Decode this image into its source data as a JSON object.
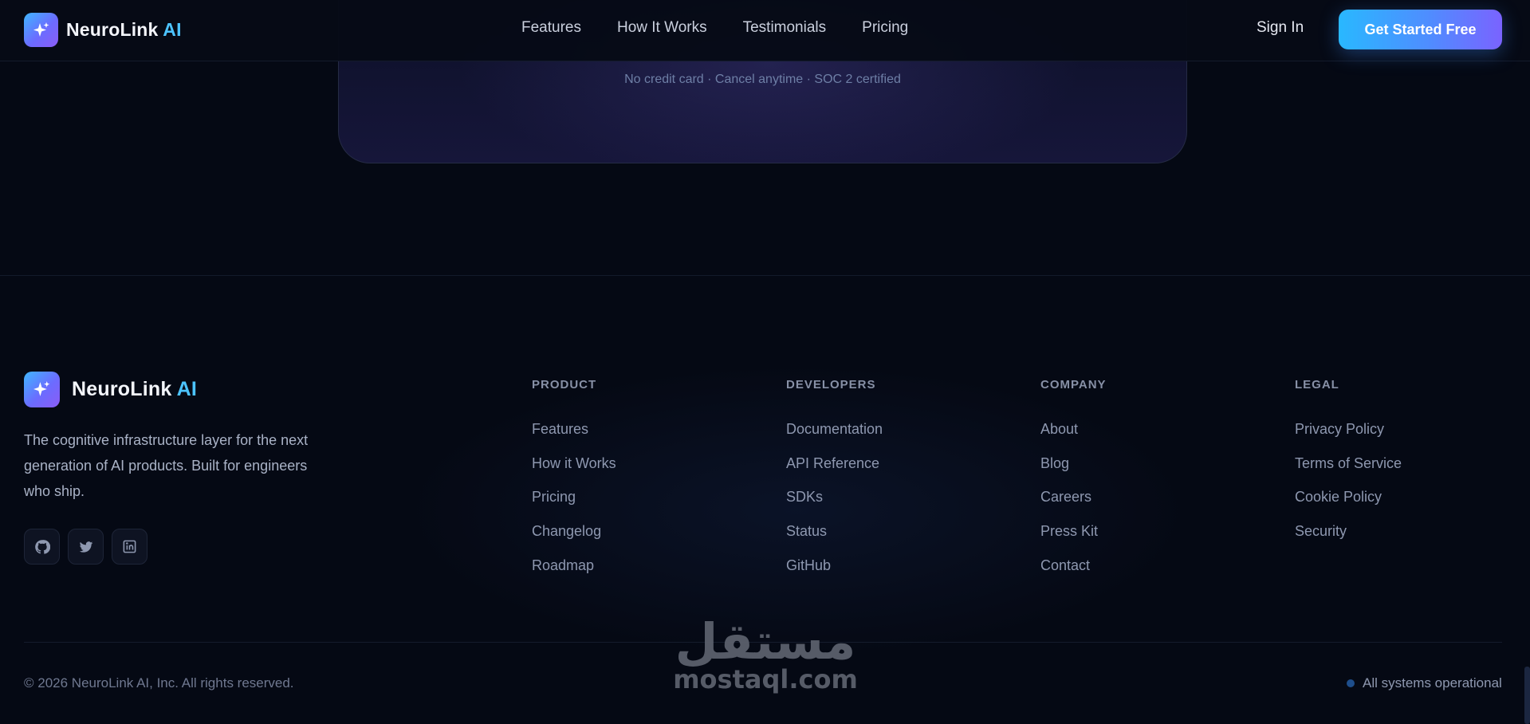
{
  "brand": {
    "name_main": "NeuroLink",
    "name_accent": "AI",
    "icon": "sparkles-icon"
  },
  "nav": {
    "links": [
      "Features",
      "How It Works",
      "Testimonials",
      "Pricing"
    ],
    "sign_in": "Sign In",
    "cta": "Get Started Free"
  },
  "cta_section": {
    "note": "No credit card · Cancel anytime · SOC 2 certified"
  },
  "footer": {
    "tagline": "The cognitive infrastructure layer for the next generation of AI products. Built for engineers who ship.",
    "socials": [
      {
        "icon": "github-icon"
      },
      {
        "icon": "twitter-icon"
      },
      {
        "icon": "linkedin-icon"
      }
    ],
    "columns": [
      {
        "title": "PRODUCT",
        "links": [
          "Features",
          "How it Works",
          "Pricing",
          "Changelog",
          "Roadmap"
        ]
      },
      {
        "title": "DEVELOPERS",
        "links": [
          "Documentation",
          "API Reference",
          "SDKs",
          "Status",
          "GitHub"
        ]
      },
      {
        "title": "COMPANY",
        "links": [
          "About",
          "Blog",
          "Careers",
          "Press Kit",
          "Contact"
        ]
      },
      {
        "title": "LEGAL",
        "links": [
          "Privacy Policy",
          "Terms of Service",
          "Cookie Policy",
          "Security"
        ]
      }
    ],
    "copyright": "© 2026 NeuroLink AI, Inc. All rights reserved.",
    "status": "All systems operational"
  },
  "watermark": {
    "arabic": "مستقل",
    "latin": "mostaql.com"
  },
  "colors": {
    "accent": "#4cc3ff",
    "cta_start": "#29b8ff",
    "cta_end": "#7a63ff",
    "background": "#050914"
  }
}
